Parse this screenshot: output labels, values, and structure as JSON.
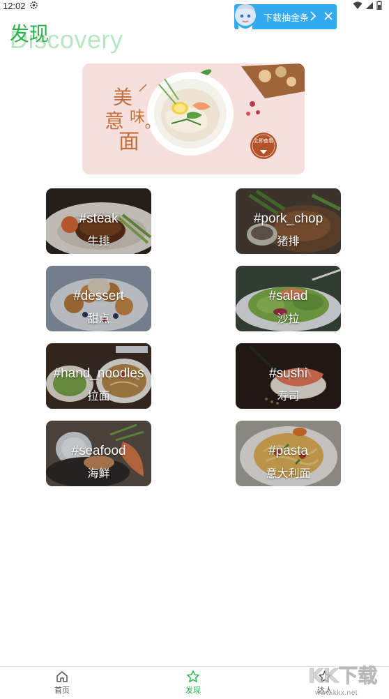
{
  "status_bar": {
    "time": "12:02"
  },
  "ad": {
    "text": "下载抽金条"
  },
  "header": {
    "title": "发现",
    "title_bg": "Discovery"
  },
  "banner": {
    "line1": "美",
    "line2": "味",
    "line3": "意",
    "line4": "面",
    "button": "立即查看"
  },
  "categories": [
    {
      "tag": "#steak",
      "name": "牛排"
    },
    {
      "tag": "#pork_chop",
      "name": "猪排"
    },
    {
      "tag": "#dessert",
      "name": "甜点"
    },
    {
      "tag": "#salad",
      "name": "沙拉"
    },
    {
      "tag": "#hand_noodles",
      "name": "拉面"
    },
    {
      "tag": "#sushi",
      "name": "寿司"
    },
    {
      "tag": "#seafood",
      "name": "海鲜"
    },
    {
      "tag": "#pasta",
      "name": "意大利面"
    }
  ],
  "bottom_nav": [
    {
      "label": "首页",
      "icon": "home-icon"
    },
    {
      "label": "发现",
      "icon": "star-icon",
      "active": true
    },
    {
      "label": "达人",
      "icon": "star-icon"
    }
  ],
  "watermark": {
    "text": "www.kkx.net",
    "logo": "KK下载"
  },
  "colors": {
    "accent": "#2bb24c",
    "ad_blue": "#33a9f2"
  }
}
